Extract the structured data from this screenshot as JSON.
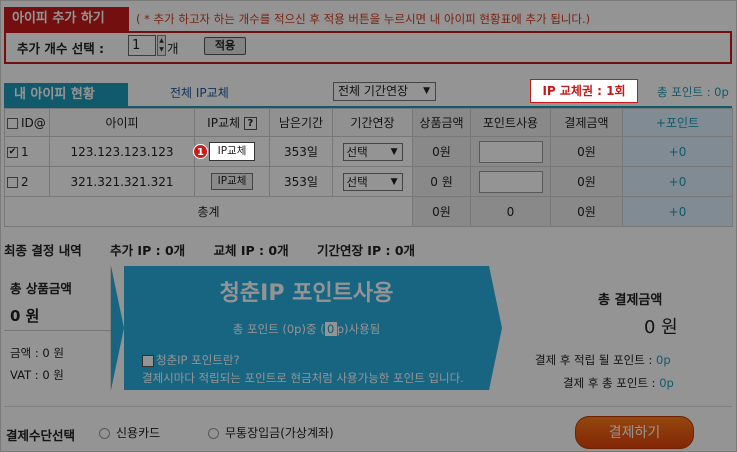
{
  "add_section": {
    "title": "아이피 추가 하기",
    "note": "( * 추가 하고자 하는 개수를 적으신 후 적용 버튼을 누르시면 내 아이피 현황표에 추가 됩니다.)",
    "count_label": "추가 개수 선택 :",
    "count_value": "1",
    "count_unit": "개",
    "apply_label": "적용"
  },
  "my_ip": {
    "title": "내 아이피 현황",
    "all_change_link": "전체 IP교체",
    "extension_select": "전체 기간연장",
    "coupon": "IP 교체권 : 1회",
    "total_point": "총 포인트 : 0p"
  },
  "table": {
    "headers": [
      "ID@",
      "아이피",
      "IP교체",
      "남은기간",
      "기간연장",
      "상품금액",
      "포인트사용",
      "결제금액",
      "+포인트"
    ],
    "rows": [
      {
        "checked": "✔",
        "id": "1",
        "ip": "123.123.123.123",
        "change": "IP교체",
        "remain": "353일",
        "extend": "선택",
        "price": "0원",
        "pay": "0원",
        "plus": "+0"
      },
      {
        "checked": "",
        "id": "2",
        "ip": "321.321.321.321",
        "change": "IP교체",
        "remain": "353일",
        "extend": "선택",
        "price": "0 원",
        "pay": "0원",
        "plus": "+0"
      }
    ],
    "total_row": {
      "label": "총계",
      "price": "0원",
      "point": "0",
      "pay": "0원",
      "plus": "+0"
    }
  },
  "badge_number": "1",
  "final": {
    "title": "최종 결정 내역",
    "add_ip": "추가 IP : 0개",
    "change_ip": "교체 IP : 0개",
    "extend_ip": "기간연장 IP : 0개"
  },
  "summary_left": {
    "title": "총 상품금액",
    "value": "0 원",
    "amount": "금액 : 0 원",
    "vat": "VAT : 0 원"
  },
  "summary_mid": {
    "title": "청춘IP 포인트사용",
    "line_a": "총 포인트 (0p)중 (",
    "line_val": "0",
    "line_b": "p)사용됨",
    "question": "청춘IP 포인트란?",
    "desc": "결제시마다 적립되는 포인트로 현금처럼 사용가능한 포인트 입니다."
  },
  "summary_right": {
    "title": "총 결제금액",
    "value": "0 원",
    "earn_label": "결제 후 적립 될 포인트 : ",
    "earn_value": "0p",
    "total_label": "결제 후 총 포인트 : ",
    "total_value": "0p"
  },
  "payment": {
    "label": "결제수단선택",
    "card": "신용카드",
    "bank": "무통장입금(가상계좌)",
    "submit": "결제하기"
  },
  "colors": {
    "accent_red": "#c61a1a",
    "accent_teal": "#1e9bb8",
    "panel_blue": "#2aaee1",
    "pay_orange": "#e2420a"
  }
}
